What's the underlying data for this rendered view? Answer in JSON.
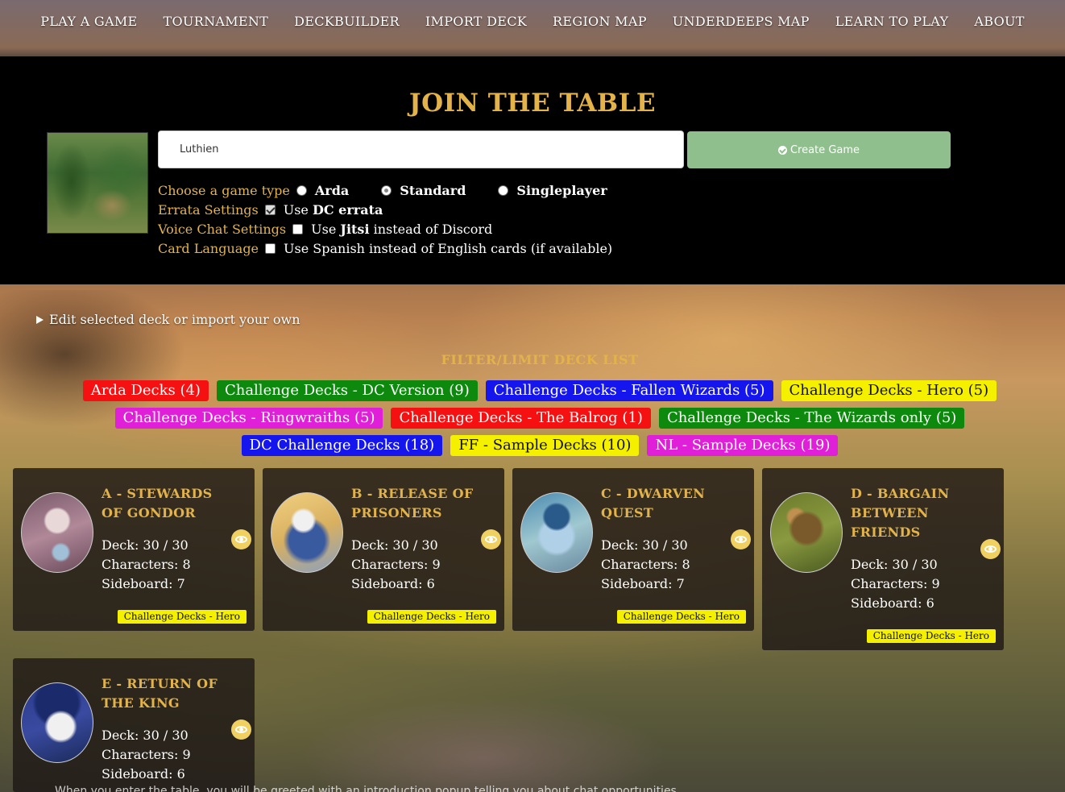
{
  "nav": {
    "items": [
      "PLAY A GAME",
      "TOURNAMENT",
      "DECKBUILDER",
      "IMPORT DECK",
      "REGION MAP",
      "UNDERDEEPS MAP",
      "LEARN TO PLAY",
      "ABOUT"
    ]
  },
  "join": {
    "title": "JOIN THE TABLE",
    "name_value": "Luthien",
    "create_label": "Create Game",
    "game_type_label": "Choose a game type",
    "game_types": [
      "Arda",
      "Standard",
      "Singleplayer"
    ],
    "game_type_selected": "Standard",
    "errata_label": "Errata Settings",
    "errata_use": "Use",
    "errata_value": "DC errata",
    "errata_checked": true,
    "voice_label": "Voice Chat Settings",
    "voice_use": "Use",
    "voice_value": "Jitsi",
    "voice_rest": "instead of Discord",
    "voice_checked": false,
    "lang_label": "Card Language",
    "lang_text": "Use Spanish instead of English cards (if available)",
    "lang_checked": false
  },
  "edit_deck_label": "Edit selected deck or import your own",
  "filter": {
    "title": "FILTER/LIMIT DECK LIST",
    "tags": [
      {
        "label": "Arda Decks (4)",
        "color": "#f51111"
      },
      {
        "label": "Challenge Decks - DC Version (9)",
        "color": "#0d8a0d"
      },
      {
        "label": "Challenge Decks - Fallen Wizards (5)",
        "color": "#1515ee"
      },
      {
        "label": "Challenge Decks - Hero (5)",
        "color": "#f5f000"
      },
      {
        "label": "Challenge Decks - Ringwraiths (5)",
        "color": "#e020d8"
      },
      {
        "label": "Challenge Decks - The Balrog (1)",
        "color": "#f51111"
      },
      {
        "label": "Challenge Decks - The Wizards only (5)",
        "color": "#0d8a0d"
      },
      {
        "label": "DC Challenge Decks (18)",
        "color": "#1515ee"
      },
      {
        "label": "FF - Sample Decks (10)",
        "color": "#f5f000"
      },
      {
        "label": "NL - Sample Decks (19)",
        "color": "#e020d8"
      }
    ]
  },
  "decks": [
    {
      "title": "A - STEWARDS OF GONDOR",
      "deck": "Deck: 30 / 30",
      "characters": "Characters: 8",
      "sideboard": "Sideboard: 7",
      "badge": "Challenge Decks - Hero"
    },
    {
      "title": "B - RELEASE OF PRISONERS",
      "deck": "Deck: 30 / 30",
      "characters": "Characters: 9",
      "sideboard": "Sideboard: 6",
      "badge": "Challenge Decks - Hero"
    },
    {
      "title": "C - DWARVEN QUEST",
      "deck": "Deck: 30 / 30",
      "characters": "Characters: 8",
      "sideboard": "Sideboard: 7",
      "badge": "Challenge Decks - Hero"
    },
    {
      "title": "D - BARGAIN BETWEEN FRIENDS",
      "deck": "Deck: 30 / 30",
      "characters": "Characters: 9",
      "sideboard": "Sideboard: 6",
      "badge": "Challenge Decks - Hero"
    },
    {
      "title": "E - RETURN OF THE KING",
      "deck": "Deck: 30 / 30",
      "characters": "Characters: 9",
      "sideboard": "Sideboard: 6",
      "badge": ""
    }
  ],
  "bottom_note": "When you enter the table, you will be greeted with an introduction popup telling you about chat opportunities"
}
